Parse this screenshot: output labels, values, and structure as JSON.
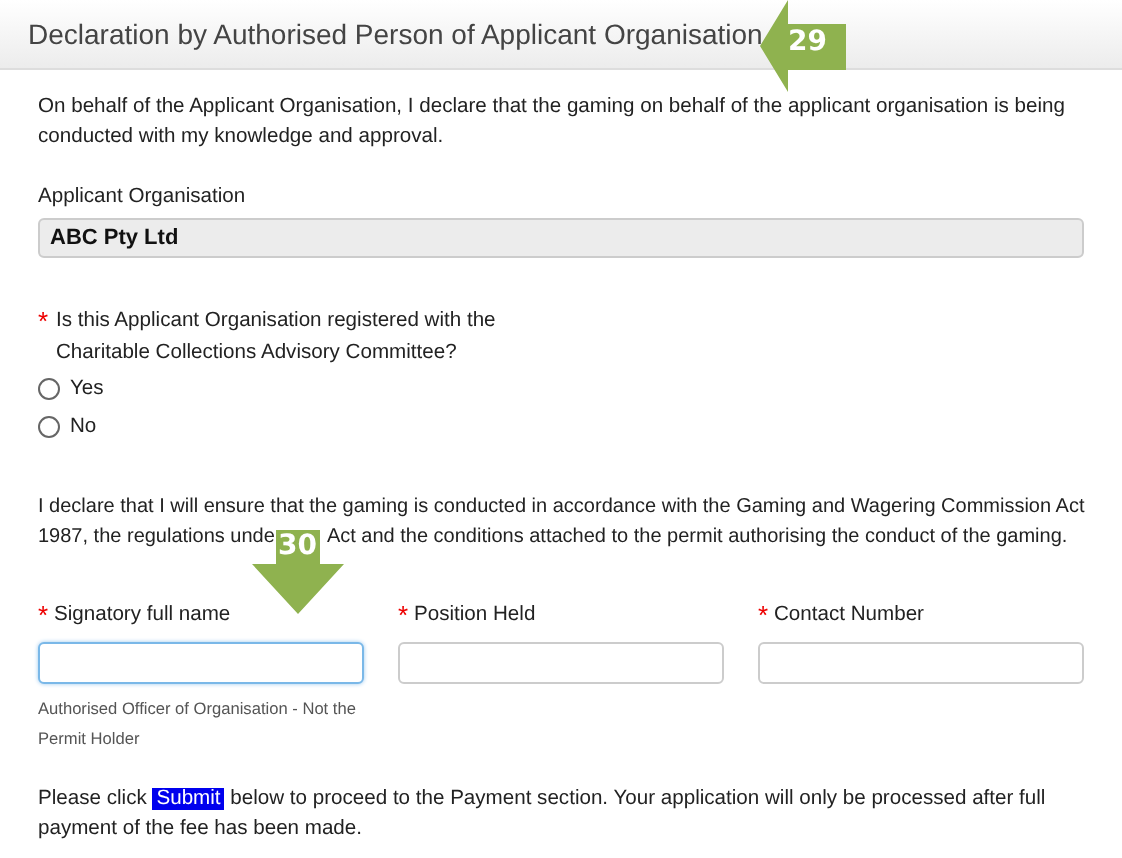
{
  "header": {
    "title": "Declaration by Authorised Person of Applicant Organisation"
  },
  "callouts": [
    {
      "label": "29",
      "kind": "left"
    },
    {
      "label": "30",
      "kind": "down"
    }
  ],
  "intro": "On behalf of the Applicant Organisation, I declare that the gaming on behalf of the applicant organisation is being conducted with my knowledge and approval.",
  "organisation": {
    "label": "Applicant Organisation",
    "value": "ABC Pty Ltd"
  },
  "question": {
    "required_mark": "*",
    "text": "Is this Applicant Organisation registered with the Charitable Collections Advisory Committee?",
    "options": [
      {
        "label": "Yes",
        "selected": false
      },
      {
        "label": "No",
        "selected": false
      }
    ]
  },
  "declaration": [
    "I declare that I will ensure that the gaming is conducted in accordance with the Gaming and Wagering Commission Act",
    "1987, the regulations unde",
    "Act and the conditions attached to the permit authorising the conduct of the gaming."
  ],
  "fields": [
    {
      "required_mark": "*",
      "label": "Signatory full name",
      "focused": true,
      "hint": "Authorised Officer of Organisation - Not the Permit Holder"
    },
    {
      "required_mark": "*",
      "label": "Position Held",
      "focused": false
    },
    {
      "required_mark": "*",
      "label": "Contact Number",
      "focused": false
    }
  ],
  "submit_note": {
    "before": "Please click ",
    "highlight": "Submit",
    "after": " below to proceed to the Payment section. Your application will only be processed after full payment of the fee has been made."
  }
}
